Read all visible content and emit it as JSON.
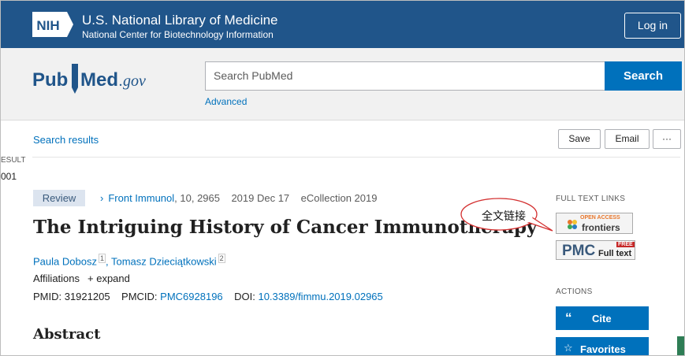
{
  "nih": {
    "badge": "NIH",
    "line1": "U.S. National Library of Medicine",
    "line2": "National Center for Biotechnology Information",
    "login": "Log in"
  },
  "pubmed": {
    "logo_pub": "Pub",
    "logo_med": "Med",
    "logo_gov": ".gov",
    "search_placeholder": "Search PubMed",
    "search_button": "Search",
    "advanced": "Advanced"
  },
  "toolbar": {
    "search_results": "Search results",
    "save": "Save",
    "email": "Email",
    "more": "···"
  },
  "result": {
    "label": "ESULT",
    "number": "001"
  },
  "article": {
    "badge": "Review",
    "journal": "Front Immunol",
    "citation": ", 10, 2965",
    "date": "2019 Dec 17",
    "ecollection": "eCollection 2019",
    "title": "The Intriguing History of Cancer Immunotherapy",
    "author1": "Paula Dobosz",
    "author1_sup": "1",
    "author2": "Tomasz Dzieciątkowski",
    "author2_sup": "2",
    "affiliations": "Affiliations",
    "expand": "+ expand",
    "pmid_label": "PMID: 31921205",
    "pmcid_label": "PMCID:",
    "pmcid": "PMC6928196",
    "doi_label": "DOI:",
    "doi": "10.3389/fimmu.2019.02965",
    "abstract_heading": "Abstract"
  },
  "sidebar": {
    "full_text_links": "FULL TEXT LINKS",
    "frontiers_small": "OPEN ACCESS",
    "frontiers_big": "frontiers",
    "pmc_big": "PMC",
    "pmc_free": "FREE",
    "pmc_full": "Full text",
    "actions": "ACTIONS",
    "cite": "Cite",
    "cite_icon": "“",
    "favorites": "Favorites",
    "favorites_icon": "☆"
  },
  "annotation": {
    "callout": "全文链接"
  },
  "colors": {
    "nih_blue": "#20558a",
    "link_blue": "#0071bc",
    "header_gray": "#f1f1f1"
  }
}
